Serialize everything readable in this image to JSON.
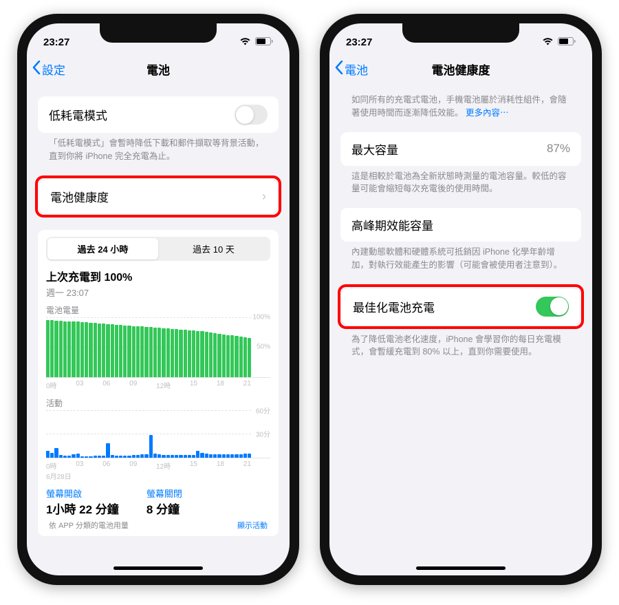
{
  "status": {
    "time": "23:27"
  },
  "left": {
    "back": "設定",
    "title": "電池",
    "lowPower": {
      "label": "低耗電模式",
      "footer": "「低耗電模式」會暫時降低下載和郵件擷取等背景活動，直到你將 iPhone 完全充電為止。"
    },
    "batteryHealth": {
      "label": "電池健康度"
    },
    "seg": {
      "a": "過去 24 小時",
      "b": "過去 10 天"
    },
    "lastCharge": {
      "title": "上次充電到 100%",
      "sub": "週一  23:07"
    },
    "chartBattery": {
      "label": "電池電量"
    },
    "chartActivity": {
      "label": "活動",
      "date": "6月28日"
    },
    "yLabelsBattery": [
      "100%",
      "50%"
    ],
    "yLabelsActivity": [
      "60分",
      "30分"
    ],
    "xTicks": [
      "0時",
      "03",
      "06",
      "09",
      "12時",
      "15",
      "18",
      "21"
    ],
    "screenOn": {
      "label": "螢幕開啟",
      "value": "1小時 22 分鐘"
    },
    "screenOff": {
      "label": "螢幕關閉",
      "value": "8 分鐘"
    },
    "cutoffLeft": "依 APP 分類的電池用量",
    "cutoffRight": "顯示活動"
  },
  "right": {
    "back": "電池",
    "title": "電池健康度",
    "intro": "如同所有的充電式電池，手機電池屬於消耗性組件，會隨著使用時間而逐漸降低效能。",
    "introLink": "更多內容⋯",
    "maxCapacity": {
      "label": "最大容量",
      "value": "87%",
      "footer": "這是相較於電池為全新狀態時測量的電池容量。較低的容量可能會縮短每次充電後的使用時間。"
    },
    "peak": {
      "label": "高峰期效能容量",
      "footer": "內建動態軟體和硬體系統可抵銷因 iPhone 化學年齡增加，對執行效能產生的影響（可能會被使用者注意到）。"
    },
    "optimized": {
      "label": "最佳化電池充電",
      "footer": "為了降低電池老化速度，iPhone 會學習你的每日充電模式，會暫緩充電到 80% 以上，直到你需要使用。"
    }
  },
  "chart_data": [
    {
      "type": "bar",
      "title": "電池電量",
      "xlabel": "時",
      "ylabel": "%",
      "ylim": [
        0,
        100
      ],
      "x_ticks": [
        "0時",
        "03",
        "06",
        "09",
        "12時",
        "15",
        "18",
        "21"
      ],
      "values": [
        95,
        95,
        94,
        94,
        93,
        93,
        92,
        92,
        91,
        91,
        90,
        90,
        89,
        89,
        88,
        88,
        87,
        87,
        86,
        86,
        85,
        85,
        84,
        83,
        83,
        82,
        82,
        81,
        81,
        80,
        80,
        79,
        79,
        78,
        78,
        77,
        76,
        75,
        74,
        73,
        72,
        71,
        70,
        69,
        68,
        67,
        66,
        65
      ]
    },
    {
      "type": "bar",
      "title": "活動",
      "xlabel": "時",
      "ylabel": "分",
      "ylim": [
        0,
        60
      ],
      "x_ticks": [
        "0時",
        "03",
        "06",
        "09",
        "12時",
        "15",
        "18",
        "21"
      ],
      "date": "6月28日",
      "values": [
        8,
        6,
        12,
        3,
        2,
        2,
        4,
        5,
        1,
        1,
        1,
        2,
        2,
        2,
        18,
        3,
        2,
        2,
        2,
        2,
        3,
        3,
        4,
        4,
        28,
        5,
        4,
        3,
        3,
        3,
        3,
        3,
        3,
        3,
        3,
        8,
        6,
        5,
        4,
        4,
        4,
        4,
        4,
        4,
        4,
        4,
        5,
        5
      ]
    }
  ]
}
